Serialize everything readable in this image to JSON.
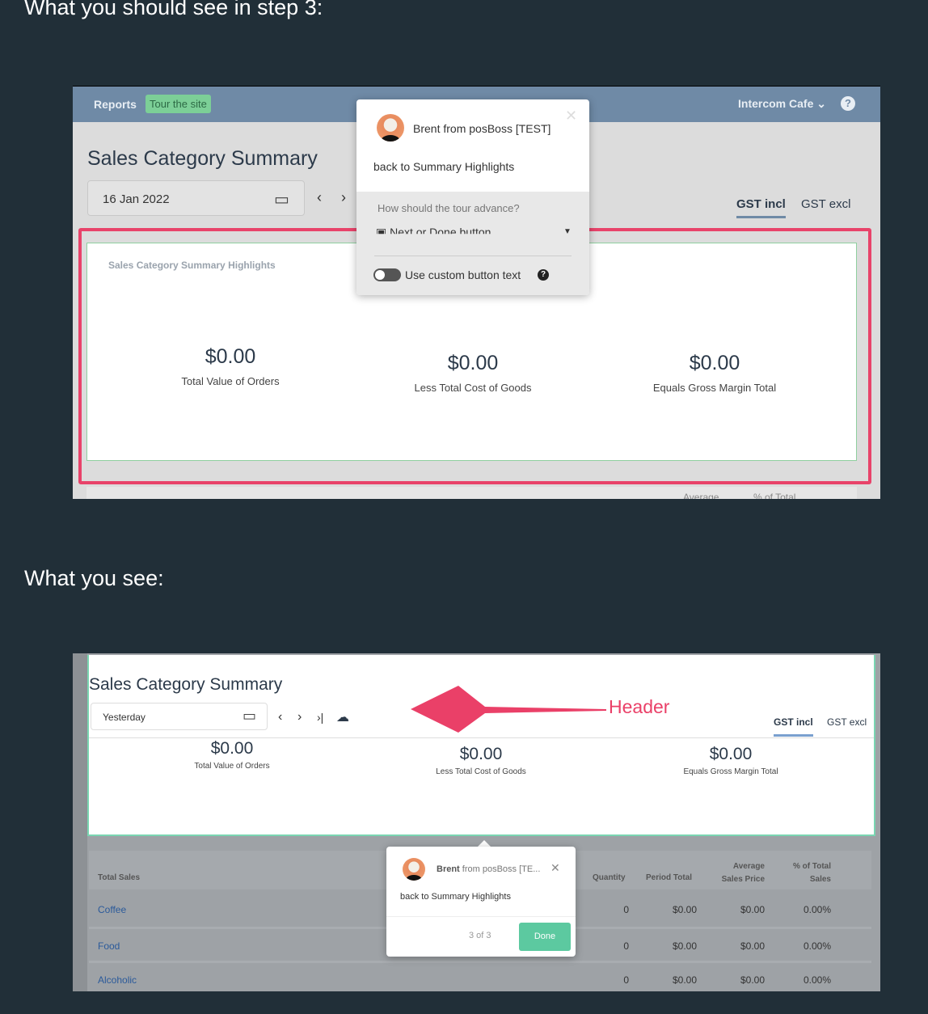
{
  "headings": {
    "step3": "What you should see in step 3:",
    "see": "What you see:"
  },
  "expected": {
    "topbar": {
      "reports": "Reports",
      "tour": "Tour the site",
      "company": "Intercom Cafe",
      "help_icon": "question-circle-icon"
    },
    "page_title": "Sales Category Summary",
    "date": "16 Jan 2022",
    "gst_tabs": [
      "GST incl",
      "GST excl"
    ],
    "card_title": "Sales Category Summary Highlights",
    "metrics": [
      {
        "value": "$0.00",
        "label": "Total Value of Orders"
      },
      {
        "value": "$0.00",
        "label": "Less Total Cost of Goods"
      },
      {
        "value": "$0.00",
        "label": "Equals Gross Margin Total"
      }
    ],
    "table_headers_partial": [
      "Average",
      "% of Total"
    ],
    "popup": {
      "author": "Brent from posBoss [TEST]",
      "message": "back to Summary Highlights",
      "advance_label": "How should the tour advance?",
      "advance_value": "Next or Done button",
      "custom_text": "Use custom button text"
    },
    "highlight_color": "#e8436a"
  },
  "actual": {
    "page_title": "Sales Category Summary",
    "date": "Yesterday",
    "annotation": "Header",
    "gst_tabs": [
      "GST incl",
      "GST excl"
    ],
    "metrics": [
      {
        "value": "$0.00",
        "label": "Total Value of Orders"
      },
      {
        "value": "$0.00",
        "label": "Less Total Cost of Goods"
      },
      {
        "value": "$0.00",
        "label": "Equals Gross Margin Total"
      }
    ],
    "table": {
      "headers": [
        "Total Sales",
        "Quantity",
        "Period Total",
        "Average Sales Price",
        "% of Total Sales"
      ],
      "rows": [
        [
          "Coffee",
          "0",
          "$0.00",
          "$0.00",
          "0.00%"
        ],
        [
          "Food",
          "0",
          "$0.00",
          "$0.00",
          "0.00%"
        ],
        [
          "Alcoholic",
          "0",
          "$0.00",
          "$0.00",
          "0.00%"
        ]
      ]
    },
    "popup": {
      "author_name": "Brent",
      "author_rest": " from posBoss [TE...",
      "message": "back to Summary Highlights",
      "step": "3 of 3",
      "done": "Done"
    },
    "accent": "#5cc9a0"
  }
}
